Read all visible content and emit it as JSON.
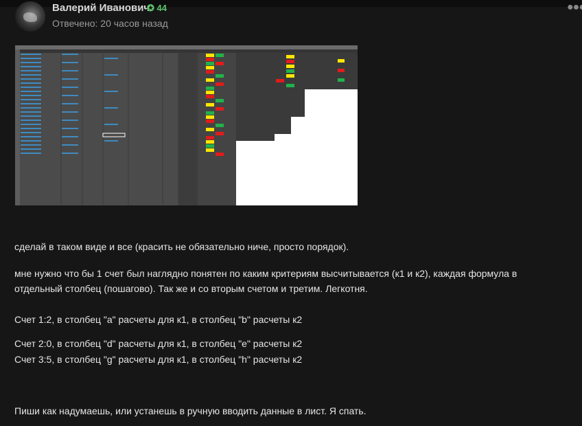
{
  "post": {
    "author": "Валерий Иванович",
    "reputation": "44",
    "answered": "Отвечено: 20 часов назад",
    "more_icon": "more-dots-icon"
  },
  "attachment": {
    "type": "spreadsheet-screenshot"
  },
  "message": {
    "p1": "сделай в таком виде и все (красить не обязательно ниче, просто порядок).",
    "p2": "мне нужно что бы 1 счет был наглядно понятен по каким критериям высчитывается (к1 и к2), каждая формула в отдельный столбец (пошагово). Так же и со вторым счетом и третим. Легкотня.",
    "p3": "Счет 1:2, в столбец \"a\" расчеты для к1, в столбец \"b\" расчеты к2",
    "p4": "Счет 2:0, в столбец \"d\" расчеты для к1, в столбец \"e\" расчеты к2",
    "p5": "Счет 3:5, в столбец \"g\" расчеты для к1, в столбец \"h\" расчеты к2",
    "p6": "Пиши как надумаешь, или устанешь в ручную вводить данные в лист. Я спать."
  },
  "colors": {
    "background": "#161616",
    "text": "#e6e6e6",
    "rep": "#5cc46a",
    "muted": "#9a9a9a"
  }
}
